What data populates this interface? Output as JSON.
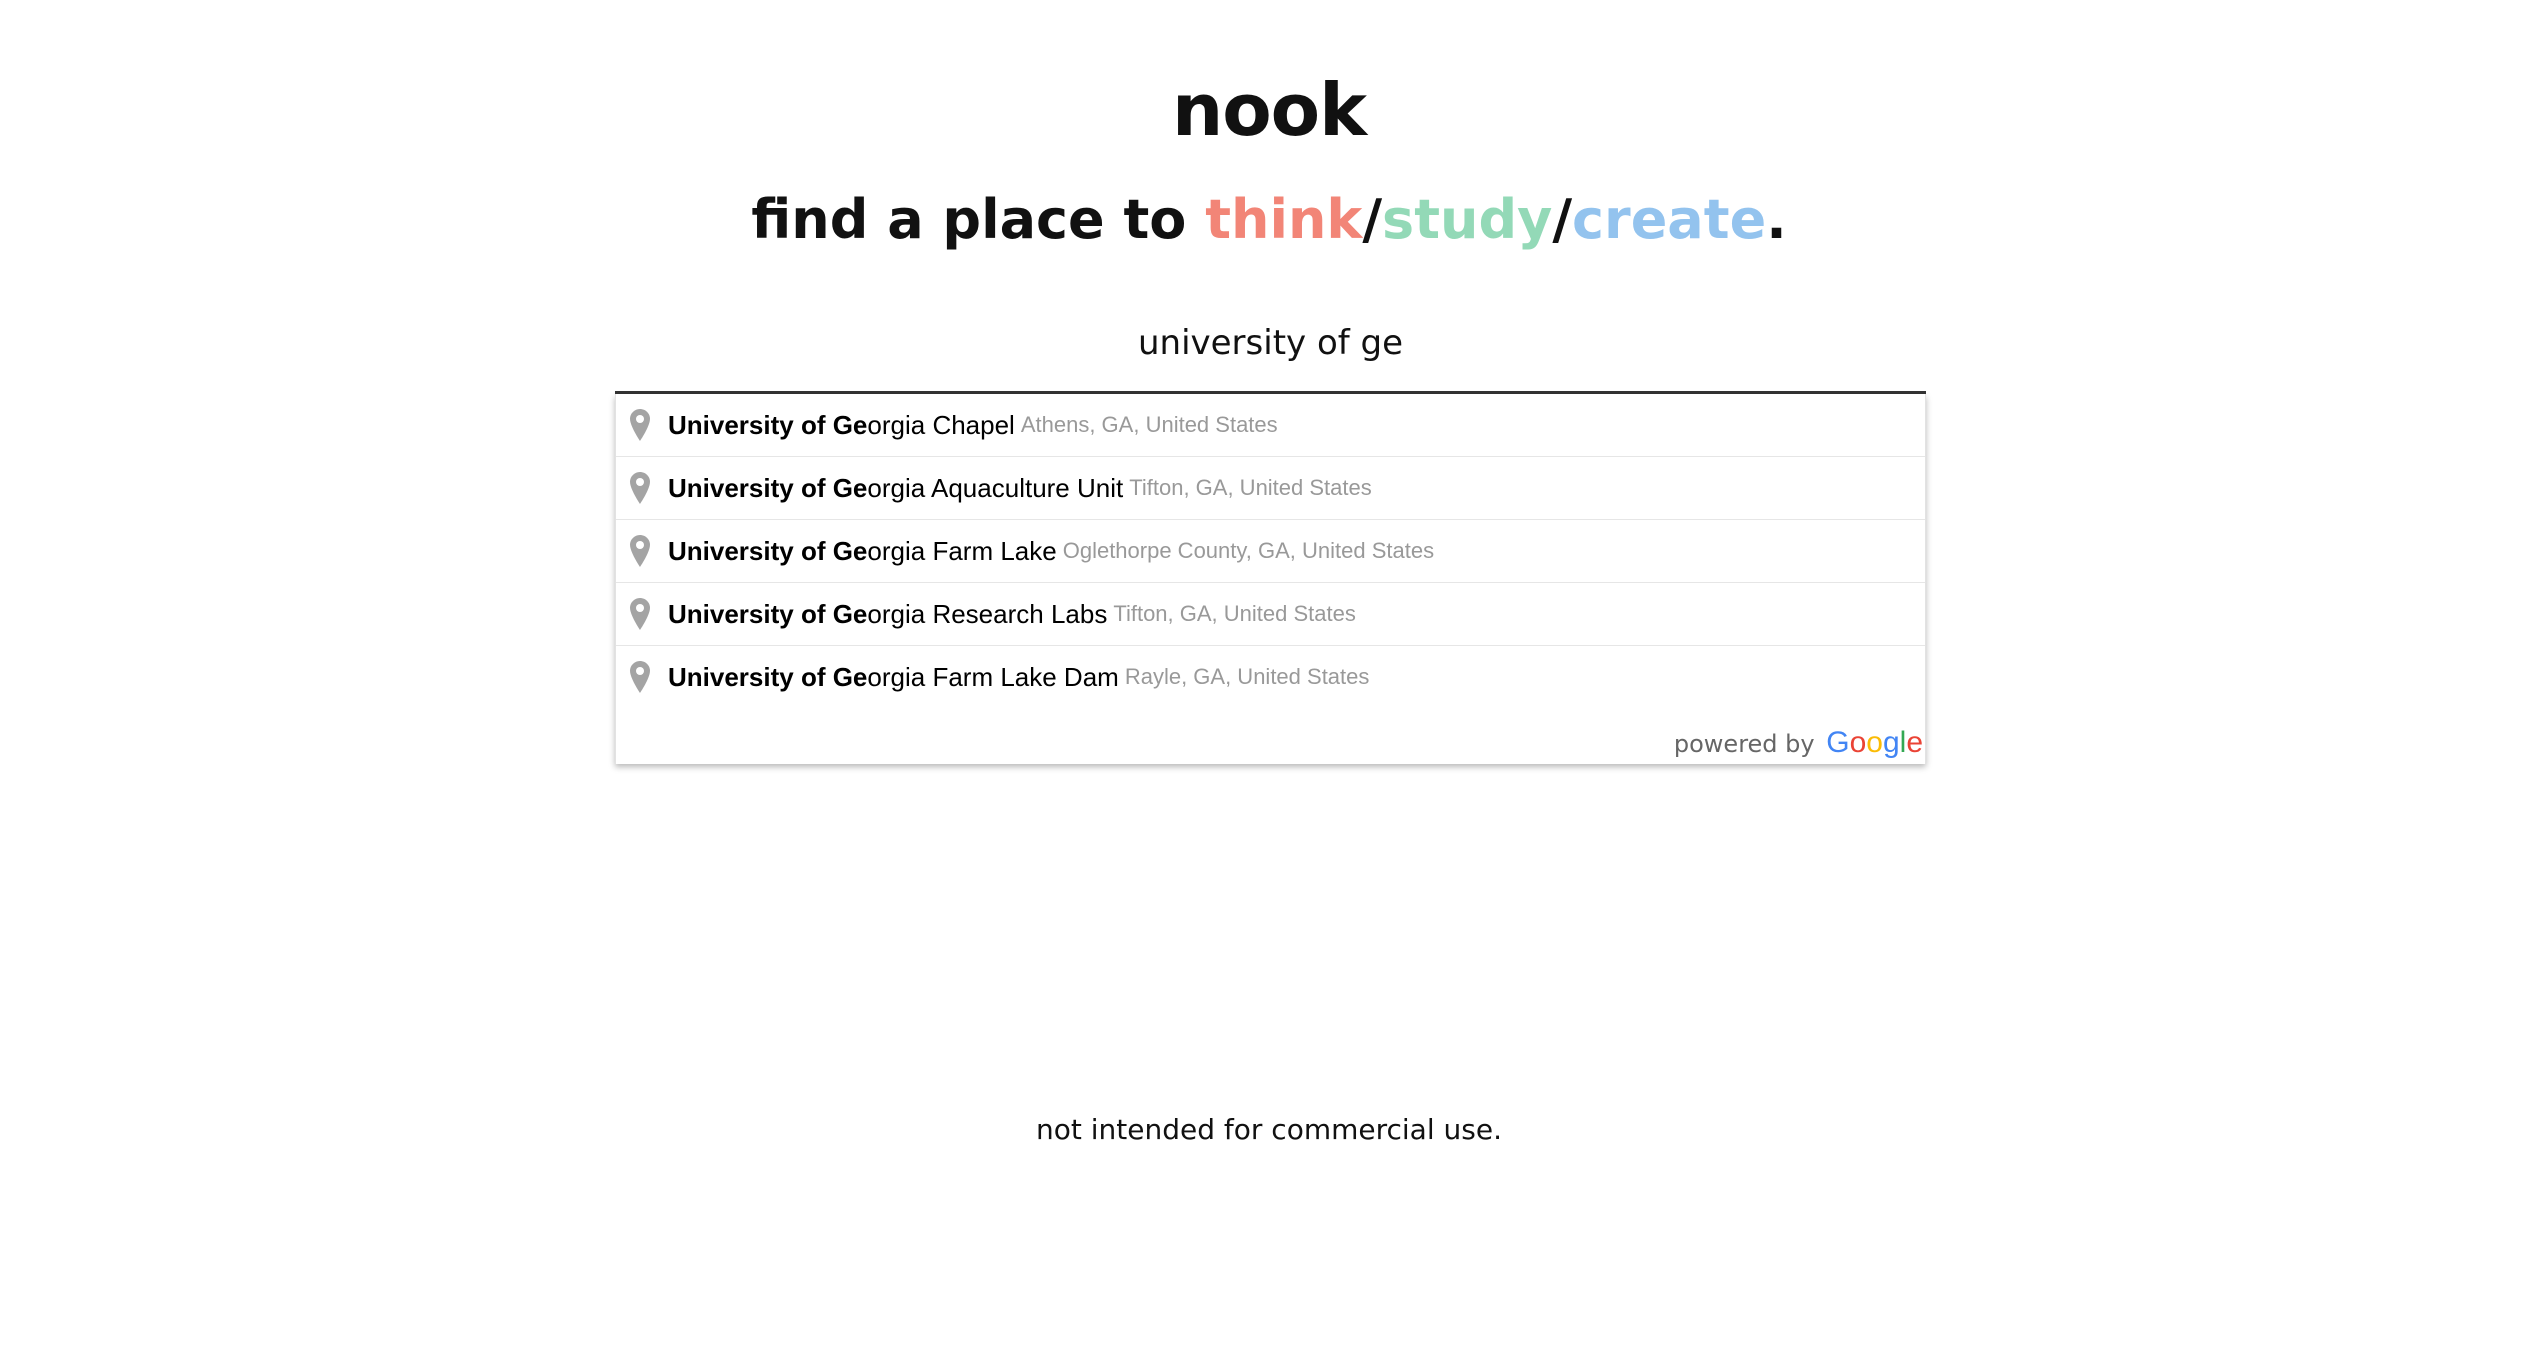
{
  "app": {
    "logo": "nook"
  },
  "tagline": {
    "prefix": "find a place to ",
    "word1": "think",
    "sep1": "/",
    "word2": "study",
    "sep2": "/",
    "word3": "create",
    "suffix": ".",
    "colors": {
      "think": "#f28577",
      "study": "#93d9b7",
      "create": "#93c3ee"
    }
  },
  "search": {
    "value": "university of ge",
    "placeholder": ""
  },
  "suggestions": {
    "pin_icon": "map-pin-icon",
    "items": [
      {
        "match": "University of Ge",
        "rest": "orgia Chapel",
        "secondary": "Athens, GA, United States"
      },
      {
        "match": "University of Ge",
        "rest": "orgia Aquaculture Unit",
        "secondary": "Tifton, GA, United States"
      },
      {
        "match": "University of Ge",
        "rest": "orgia Farm Lake",
        "secondary": "Oglethorpe County, GA, United States"
      },
      {
        "match": "University of Ge",
        "rest": "orgia Research Labs",
        "secondary": "Tifton, GA, United States"
      },
      {
        "match": "University of Ge",
        "rest": "orgia Farm Lake Dam",
        "secondary": "Rayle, GA, United States"
      }
    ],
    "powered_by": "powered by",
    "google_letters": [
      {
        "ch": "G",
        "color": "#4285F4"
      },
      {
        "ch": "o",
        "color": "#EA4335"
      },
      {
        "ch": "o",
        "color": "#FBBC05"
      },
      {
        "ch": "g",
        "color": "#4285F4"
      },
      {
        "ch": "l",
        "color": "#34A853"
      },
      {
        "ch": "e",
        "color": "#EA4335"
      }
    ]
  },
  "footer": {
    "text": "not intended for commercial use."
  }
}
